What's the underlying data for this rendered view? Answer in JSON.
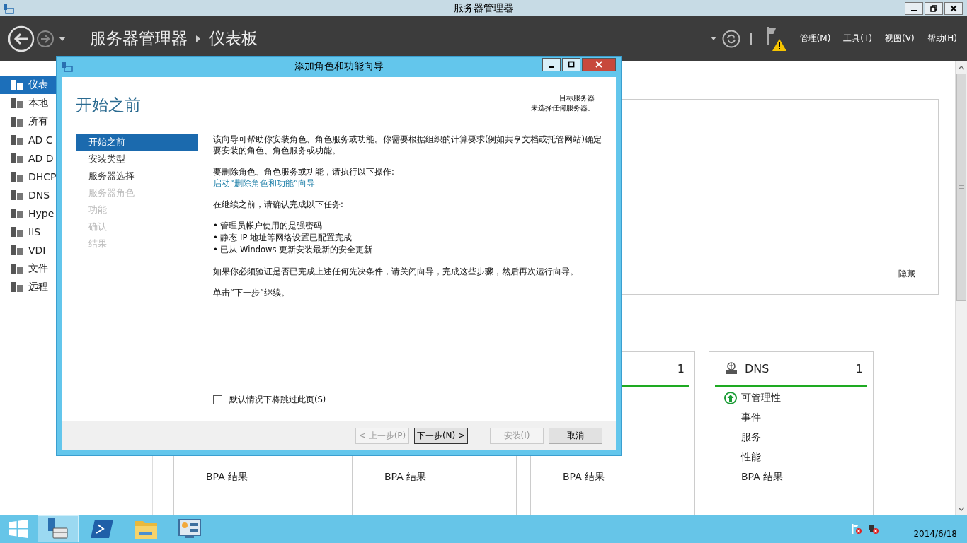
{
  "window": {
    "title": "服务器管理器"
  },
  "header": {
    "breadcrumb": [
      {
        "text": "服务器管理器"
      },
      {
        "text": "仪表板"
      }
    ],
    "menus": [
      "管理(M)",
      "工具(T)",
      "视图(V)",
      "帮助(H)"
    ]
  },
  "sidebar": {
    "items": [
      {
        "label": "仪表",
        "selected": true
      },
      {
        "label": "本地",
        "selected": false
      },
      {
        "label": "所有",
        "selected": false
      },
      {
        "label": "AD C",
        "selected": false
      },
      {
        "label": "AD D",
        "selected": false
      },
      {
        "label": "DHCP",
        "selected": false
      },
      {
        "label": "DNS",
        "selected": false
      },
      {
        "label": "Hype",
        "selected": false
      },
      {
        "label": "IIS",
        "selected": false
      },
      {
        "label": "VDI",
        "selected": false
      },
      {
        "label": "文件",
        "selected": false
      },
      {
        "label": "远程",
        "selected": false
      }
    ]
  },
  "welcome": {
    "hide_link": "隐藏"
  },
  "tiles": [
    {
      "rows": [
        {
          "text": "BPA 结果"
        }
      ]
    },
    {
      "rows": [
        {
          "text": "BPA 结果"
        }
      ]
    },
    {
      "count": "1",
      "rows": [
        {
          "text": "BPA 结果"
        }
      ]
    },
    {
      "title": "DNS",
      "count": "1",
      "rows": [
        {
          "text": "可管理性",
          "healthy": true
        },
        {
          "text": "事件"
        },
        {
          "text": "服务"
        },
        {
          "text": "性能"
        },
        {
          "text": "BPA 结果"
        }
      ]
    }
  ],
  "dialog": {
    "title": "添加角色和功能向导",
    "heading": "开始之前",
    "target_label": "目标服务器",
    "target_value": "未选择任何服务器。",
    "steps": [
      {
        "label": "开始之前",
        "selected": true,
        "disabled": false
      },
      {
        "label": "安装类型",
        "selected": false,
        "disabled": false
      },
      {
        "label": "服务器选择",
        "selected": false,
        "disabled": false
      },
      {
        "label": "服务器角色",
        "selected": false,
        "disabled": true
      },
      {
        "label": "功能",
        "selected": false,
        "disabled": true
      },
      {
        "label": "确认",
        "selected": false,
        "disabled": true
      },
      {
        "label": "结果",
        "selected": false,
        "disabled": true
      }
    ],
    "intro": "该向导可帮助你安装角色、角色服务或功能。你需要根据组织的计算要求(例如共享文档或托管网站)确定要安装的角色、角色服务或功能。",
    "remove_text": "要删除角色、角色服务或功能，请执行以下操作:",
    "remove_link": "启动“删除角色和功能”向导",
    "tasks_intro": "在继续之前，请确认完成以下任务:",
    "tasks": [
      "• 管理员帐户使用的是强密码",
      "• 静态 IP 地址等网络设置已配置完成",
      "• 已从 Windows 更新安装最新的安全更新"
    ],
    "verify_text": "如果你必须验证是否已完成上述任何先决条件，请关闭向导，完成这些步骤，然后再次运行向导。",
    "next_hint": "单击“下一步”继续。",
    "skip_checkbox": {
      "label": "默认情况下将跳过此页(S)",
      "checked": false
    },
    "buttons": [
      {
        "label": "< 上一步(P)",
        "disabled": true,
        "default": false
      },
      {
        "label": "下一步(N) >",
        "disabled": false,
        "default": true
      },
      {
        "label": "安装(I)",
        "disabled": true,
        "default": false
      },
      {
        "label": "取消",
        "disabled": false,
        "default": false
      }
    ]
  },
  "taskbar": {
    "apps": [
      {
        "kind": "server-manager",
        "selected": true
      },
      {
        "kind": "powershell",
        "selected": false
      },
      {
        "kind": "explorer",
        "selected": false
      },
      {
        "kind": "control-panel",
        "selected": false
      }
    ],
    "date": "2014/6/18"
  }
}
